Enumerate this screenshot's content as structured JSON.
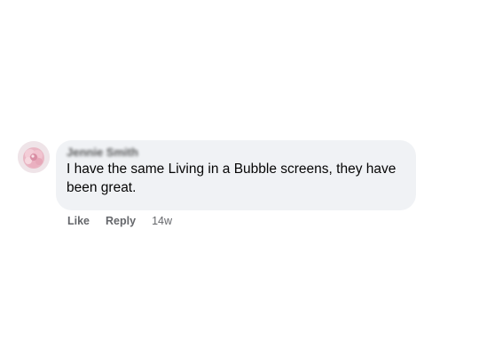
{
  "comment": {
    "author": "Jennie Smith",
    "text": "I have the same Living in a Bubble screens, they have been great.",
    "avatar_icon": "profile-photo-pink-flower",
    "actions": {
      "like_label": "Like",
      "reply_label": "Reply"
    },
    "timestamp": "14w"
  },
  "colors": {
    "bubble_bg": "#f0f2f5",
    "text": "#050505",
    "secondary_text": "#65676b"
  }
}
